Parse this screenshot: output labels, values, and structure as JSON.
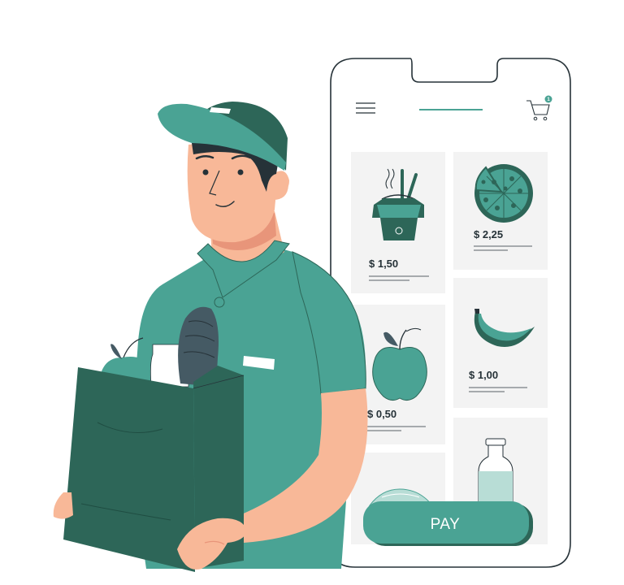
{
  "colors": {
    "primary": "#4aa394",
    "dark": "#2d6658",
    "skin": "#f8b898",
    "skin_shade": "#e8957a",
    "card_bg": "#f3f3f3",
    "outline": "#263238",
    "bag_item": "#455a64"
  },
  "phone": {
    "menu_icon": "hamburger-menu-icon",
    "cart_icon": "shopping-cart-icon",
    "cart_badge": "1",
    "products": [
      {
        "name": "noodle-box",
        "price": "$ 1,50",
        "icon": "noodle-box-icon"
      },
      {
        "name": "pizza",
        "price": "$ 2,25",
        "icon": "pizza-icon"
      },
      {
        "name": "apple",
        "price": "$ 0,50",
        "icon": "apple-icon"
      },
      {
        "name": "banana",
        "price": "$ 1,00",
        "icon": "banana-icon"
      },
      {
        "name": "watermelon",
        "price": "",
        "icon": "watermelon-icon"
      },
      {
        "name": "milk",
        "price": "",
        "icon": "milk-bottle-icon"
      }
    ],
    "pay_label": "PAY"
  },
  "courier": {
    "icon": "delivery-man-illustration",
    "bag_icon": "grocery-bag-icon"
  }
}
